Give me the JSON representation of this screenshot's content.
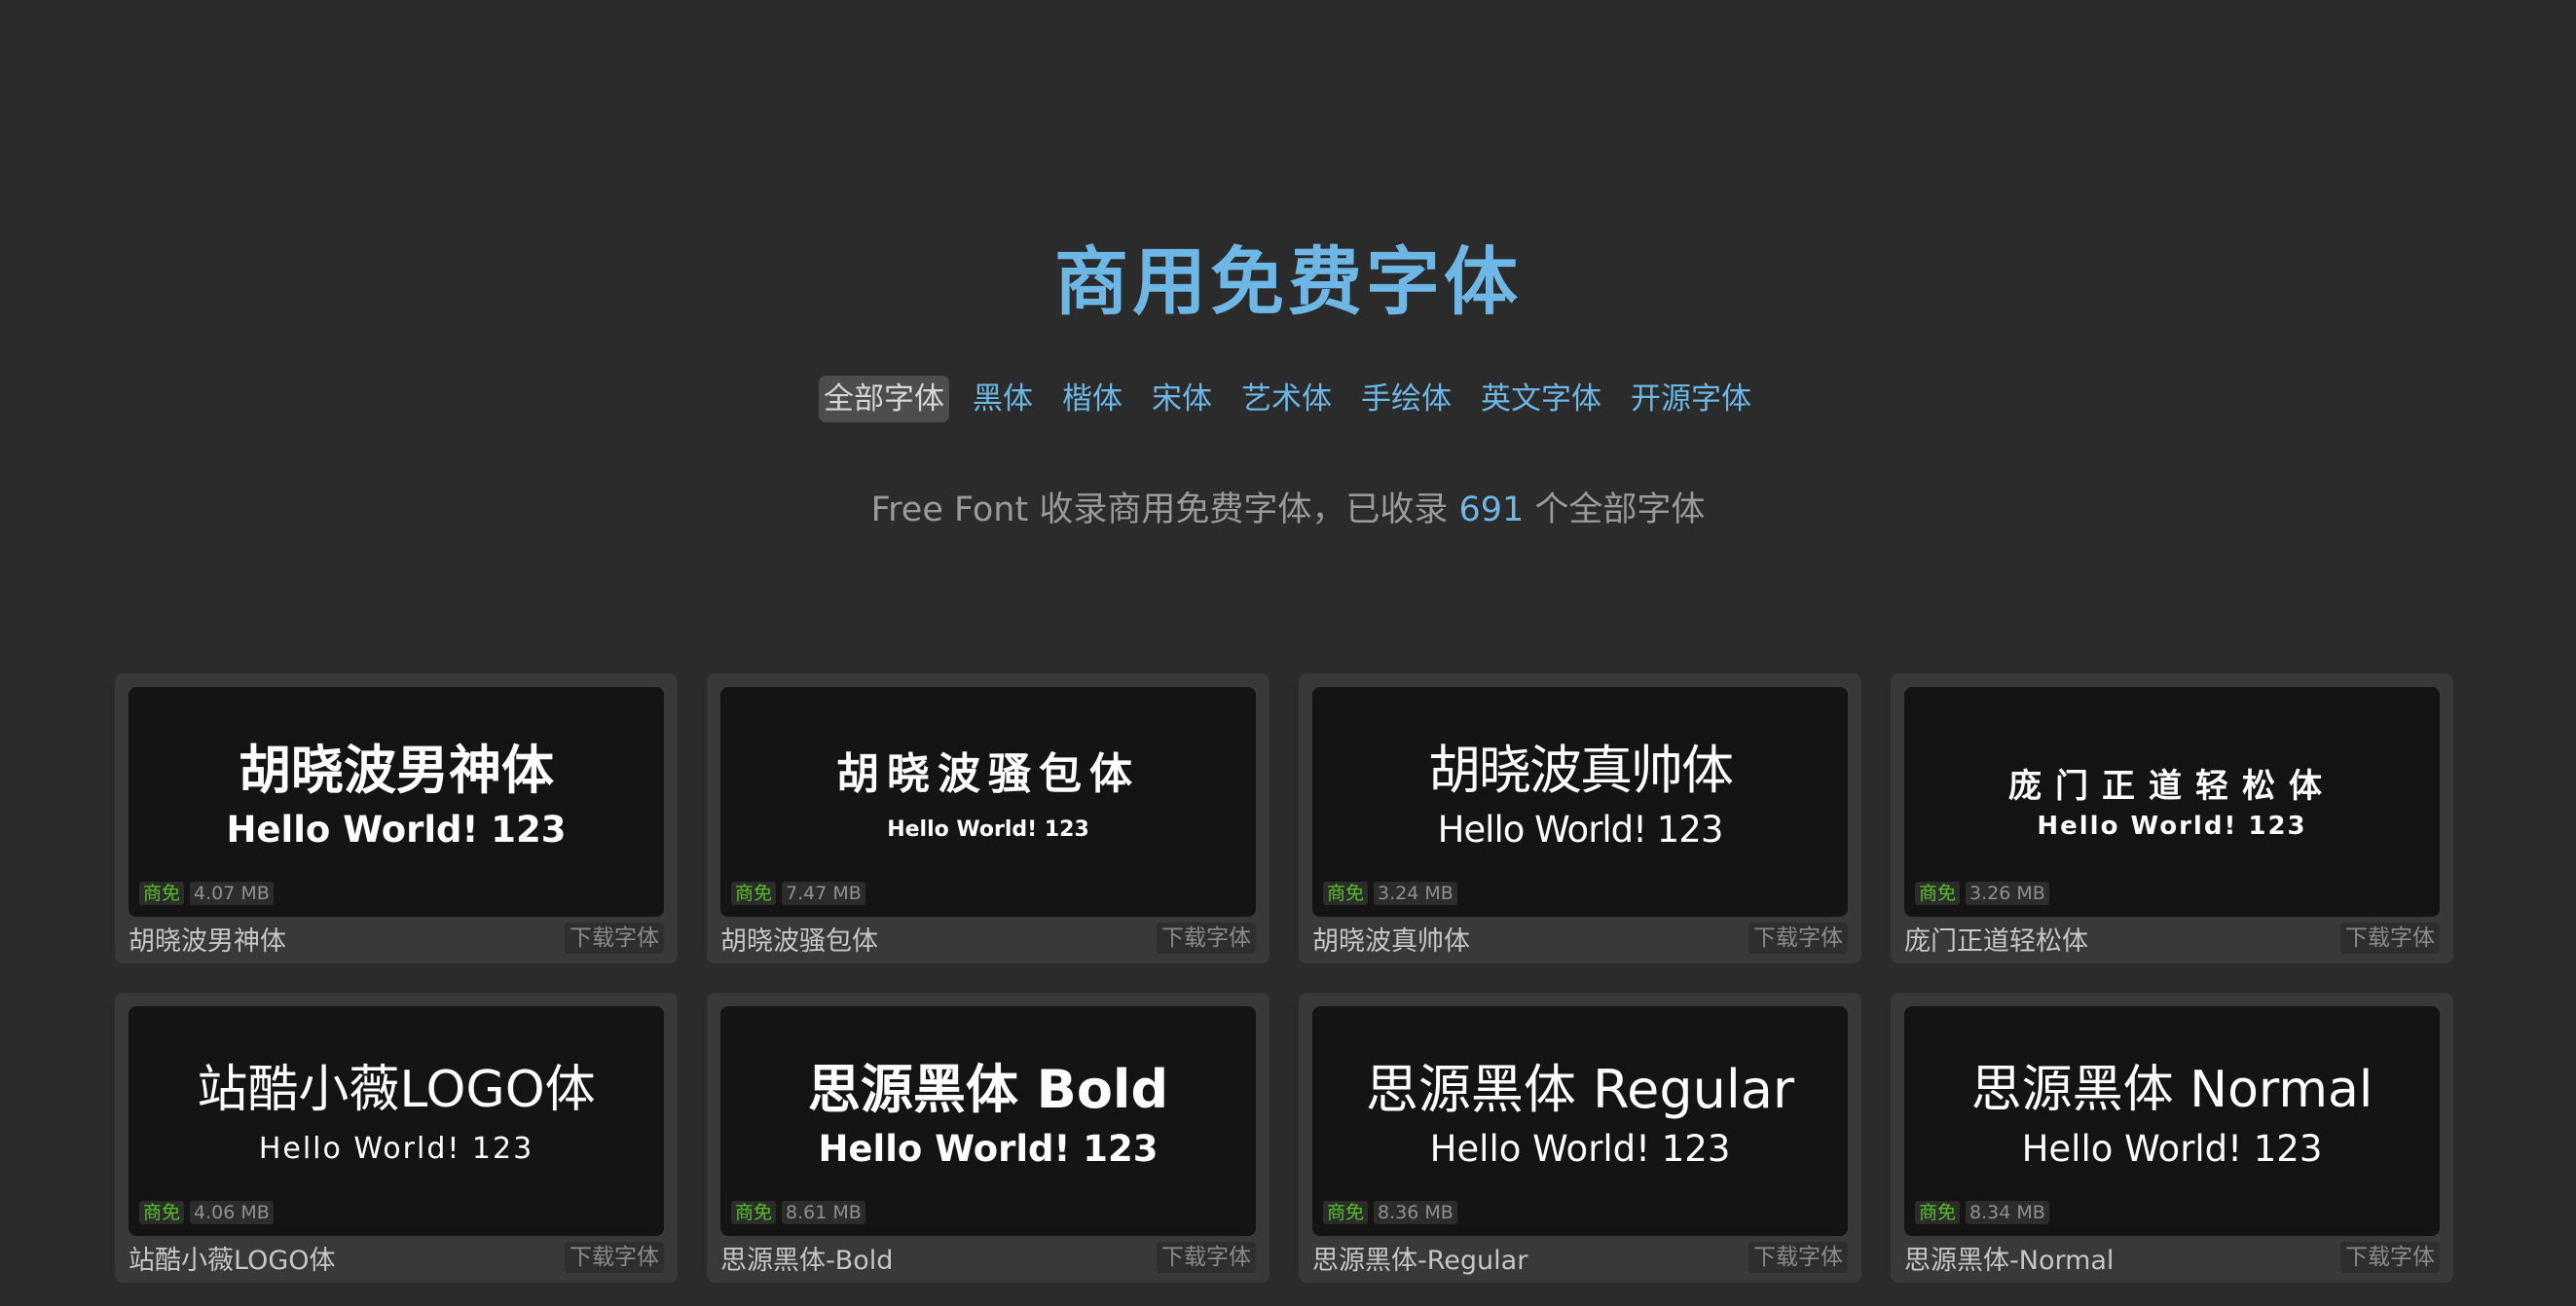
{
  "hero": {
    "title": "商用免费字体"
  },
  "nav": {
    "items": [
      {
        "label": "全部字体",
        "active": true
      },
      {
        "label": "黑体"
      },
      {
        "label": "楷体"
      },
      {
        "label": "宋体"
      },
      {
        "label": "艺术体"
      },
      {
        "label": "手绘体"
      },
      {
        "label": "英文字体"
      },
      {
        "label": "开源字体"
      }
    ]
  },
  "subtitle": {
    "prefix": "Free Font 收录商用免费字体，已收录 ",
    "count": "691",
    "suffix": " 个全部字体"
  },
  "fonts": [
    {
      "preview_title": "胡晓波男神体",
      "preview_sample": "Hello World! 123",
      "license": "商免",
      "size": "4.07 MB",
      "name": "胡晓波男神体",
      "download_label": "下载字体"
    },
    {
      "preview_title": "胡晓波骚包体",
      "preview_sample": "Hello World! 123",
      "license": "商免",
      "size": "7.47 MB",
      "name": "胡晓波骚包体",
      "download_label": "下载字体"
    },
    {
      "preview_title": "胡晓波真帅体",
      "preview_sample": "Hello World! 123",
      "license": "商免",
      "size": "3.24 MB",
      "name": "胡晓波真帅体",
      "download_label": "下载字体"
    },
    {
      "preview_title": "庞门正道轻松体",
      "preview_sample": "Hello World! 123",
      "license": "商免",
      "size": "3.26 MB",
      "name": "庞门正道轻松体",
      "download_label": "下载字体"
    },
    {
      "preview_title": "站酷小薇LOGO体",
      "preview_sample": "Hello World! 123",
      "license": "商免",
      "size": "4.06 MB",
      "name": "站酷小薇LOGO体",
      "download_label": "下载字体"
    },
    {
      "preview_title": "思源黑体 Bold",
      "preview_sample": "Hello World! 123",
      "license": "商免",
      "size": "8.61 MB",
      "name": "思源黑体-Bold",
      "download_label": "下载字体"
    },
    {
      "preview_title": "思源黑体 Regular",
      "preview_sample": "Hello World! 123",
      "license": "商免",
      "size": "8.36 MB",
      "name": "思源黑体-Regular",
      "download_label": "下载字体"
    },
    {
      "preview_title": "思源黑体 Normal",
      "preview_sample": "Hello World! 123",
      "license": "商免",
      "size": "8.34 MB",
      "name": "思源黑体-Normal",
      "download_label": "下载字体"
    }
  ],
  "colors": {
    "background": "#2b2b2c",
    "accent": "#6cb7e6",
    "card": "#39393a",
    "preview": "#141414",
    "license_badge": "#52c41a"
  }
}
